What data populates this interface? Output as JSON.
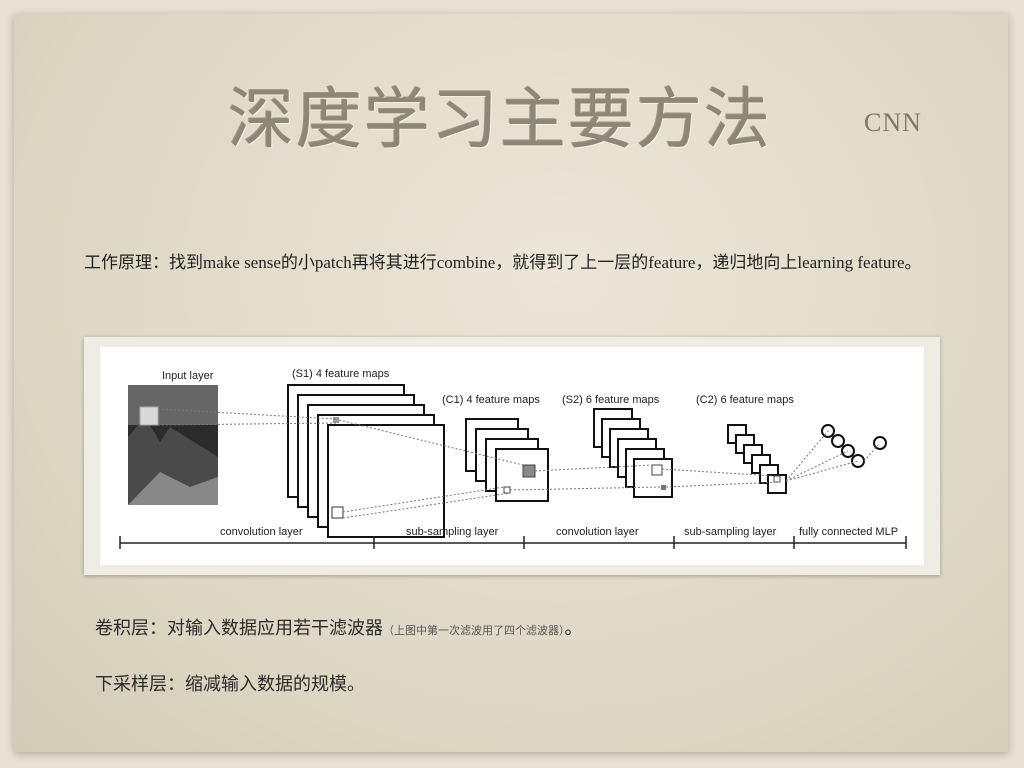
{
  "slide": {
    "title": "深度学习主要方法",
    "title_sub": "CNN",
    "principle": {
      "label": "工作原理",
      "text": "：找到make sense的小patch再将其进行combine，就得到了上一层的feature，递归地向上learning feature。"
    },
    "figure": {
      "input_label": "Input layer",
      "s1_label": "(S1) 4 feature maps",
      "c1_label": "(C1) 4 feature maps",
      "s2_label": "(S2) 6 feature maps",
      "c2_label": "(C2) 6 feature maps",
      "bottom_labels": [
        "convolution layer",
        "sub-sampling layer",
        "convolution layer",
        "sub-sampling layer",
        "fully connected MLP"
      ]
    },
    "notes": {
      "conv_main": "卷积层：对输入数据应用若干滤波器",
      "conv_small": "（上图中第一次滤波用了四个滤波器）",
      "conv_end": "。",
      "pool": "下采样层：缩减输入数据的规模。"
    }
  }
}
